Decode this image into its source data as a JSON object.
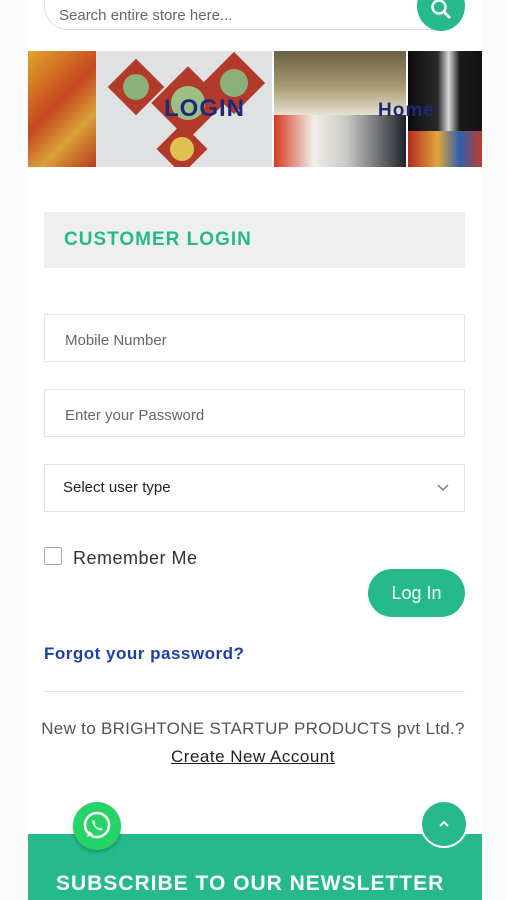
{
  "search": {
    "placeholder": "Search entire store here...",
    "icon": "search-icon"
  },
  "banner": {
    "left_text": "LOGIN",
    "right_text": "Home"
  },
  "login": {
    "heading": "CUSTOMER LOGIN",
    "mobile_placeholder": "Mobile Number",
    "password_placeholder": "Enter your Password",
    "user_type_selected": "Select user type",
    "remember_label": "Remember Me",
    "login_button": "Log In",
    "forgot_link": "Forgot your password?"
  },
  "register": {
    "prompt": "New to BRIGHTONE STARTUP PRODUCTS pvt Ltd.?",
    "create_link": "Create New Account"
  },
  "newsletter": {
    "heading": "SUBSCRIBE TO OUR NEWSLETTER"
  },
  "floating": {
    "whatsapp_icon": "whatsapp-icon",
    "scroll_top_icon": "chevron-up-icon"
  },
  "colors": {
    "accent": "#26b98c",
    "link": "#1f3fa3",
    "banner_text": "#1c2a7a"
  }
}
